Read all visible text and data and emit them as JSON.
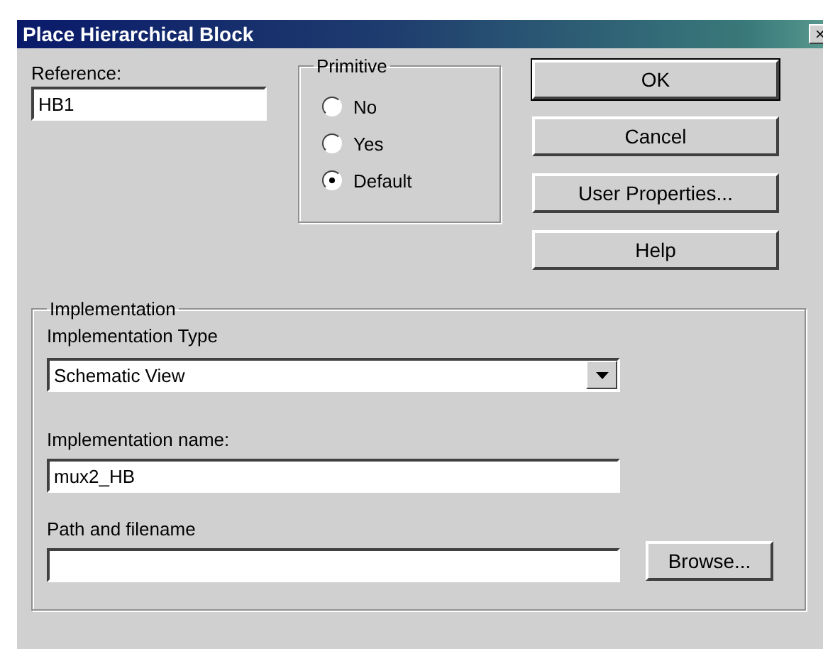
{
  "window": {
    "title": "Place Hierarchical Block",
    "close": "×"
  },
  "reference": {
    "label": "Reference:",
    "value": "HB1"
  },
  "primitive": {
    "title": "Primitive",
    "options": [
      {
        "label": "No",
        "selected": false
      },
      {
        "label": "Yes",
        "selected": false
      },
      {
        "label": "Default",
        "selected": true
      }
    ]
  },
  "buttons": [
    {
      "label": "OK",
      "default": true
    },
    {
      "label": "Cancel",
      "default": false
    },
    {
      "label": "User Properties...",
      "default": false
    },
    {
      "label": "Help",
      "default": false
    }
  ],
  "implementation": {
    "title": "Implementation",
    "type_label": "Implementation Type",
    "type_value": "Schematic View",
    "name_label": "Implementation name:",
    "name_value": "mux2_HB",
    "path_label": "Path and filename",
    "browse": "Browse..."
  }
}
